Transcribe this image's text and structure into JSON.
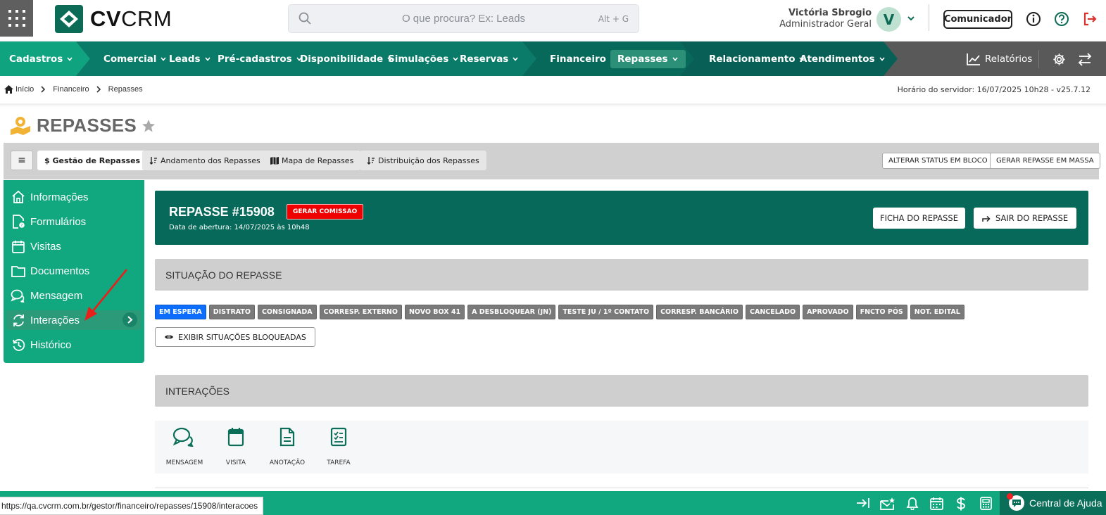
{
  "header": {
    "logo": {
      "bold": "CV",
      "light": "CRM"
    },
    "search_placeholder": "O que procura? Ex: Leads",
    "search_shortcut": "Alt + G",
    "user_name": "Victória Sbrogio",
    "user_role": "Administrador Geral",
    "avatar_letter": "V",
    "communicator": "Comunicador"
  },
  "nav": {
    "items": [
      "Cadastros",
      "Comercial",
      "Leads",
      "Pré-cadastros",
      "Disponibilidade",
      "Simulações",
      "Reservas",
      "Financeiro",
      "Repasses",
      "Relacionamento",
      "Atendimentos"
    ],
    "reports": "Relatórios",
    "active": "Repasses",
    "colors": {
      "dark": "#595959",
      "green": "#0fa37f",
      "teal": "#0a7b68",
      "dark_teal": "#075f55"
    }
  },
  "breadcrumb": [
    "Início",
    "Financeiro",
    "Repasses"
  ],
  "server_time": "Horário do servidor: 16/07/2025 10h28 - v25.7.12",
  "page_title": "REPASSES",
  "tabs": {
    "menu": "≡",
    "items": [
      "$ Gestão de Repasses",
      "Andamento dos Repasses",
      "Mapa de Repasses",
      "Distribuição dos Repasses"
    ],
    "actions": [
      "ALTERAR STATUS EM BLOCO",
      "GERAR REPASSE EM MASSA"
    ]
  },
  "sidebar": {
    "items": [
      {
        "label": "Informações",
        "icon": "home-icon"
      },
      {
        "label": "Formulários",
        "icon": "form-icon"
      },
      {
        "label": "Visitas",
        "icon": "calendar-icon"
      },
      {
        "label": "Documentos",
        "icon": "folder-icon"
      },
      {
        "label": "Mensagem",
        "icon": "chat-icon"
      },
      {
        "label": "Interações",
        "icon": "sync-icon"
      },
      {
        "label": "Histórico",
        "icon": "history-icon"
      }
    ],
    "active": "Interações"
  },
  "repasse": {
    "title": "REPASSE #15908",
    "badge": "GERAR COMISSAO",
    "opened": "Data de abertura: 14/07/2025 às 10h48",
    "btn_ficha": "FICHA DO REPASSE",
    "btn_sair": "SAIR DO REPASSE"
  },
  "situacao": {
    "title": "SITUAÇÃO DO REPASSE",
    "chips": [
      "EM ESPERA",
      "DISTRATO",
      "CONSIGNADA",
      "CORRESP. EXTERNO",
      "NOVO BOX 41",
      "A DESBLOQUEAR (JN)",
      "TESTE JU / 1º CONTATO",
      "CORRESP. BANCÁRIO",
      "CANCELADO",
      "APROVADO",
      "FNCTO PÓS",
      "NOT. EDITAL"
    ],
    "show_blocked": "EXIBIR SITUAÇÕES BLOQUEADAS"
  },
  "interacoes": {
    "title": "INTERAÇÕES",
    "actions": [
      "MENSAGEM",
      "VISITA",
      "ANOTAÇÃO",
      "TAREFA"
    ]
  },
  "status_url": "https://qa.cvcrm.com.br/gestor/financeiro/repasses/15908/interacoes",
  "help": "Central de Ajuda"
}
